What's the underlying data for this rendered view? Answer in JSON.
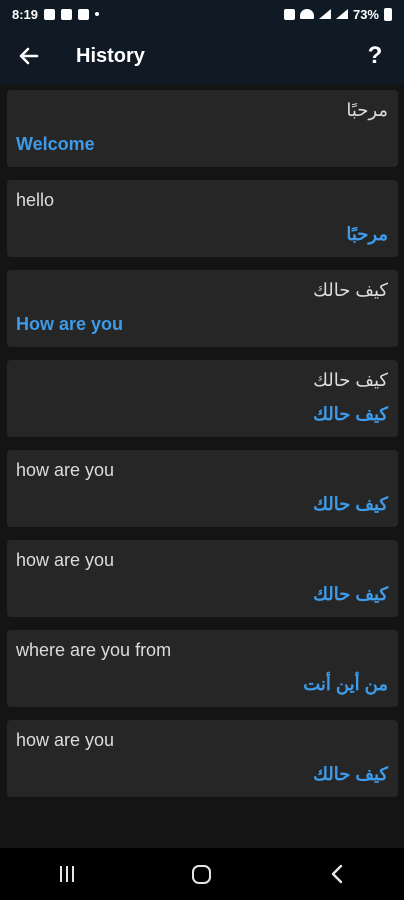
{
  "status_bar": {
    "time": "8:19",
    "battery": "73%"
  },
  "app_bar": {
    "back_icon": "arrow-left-icon",
    "title": "History",
    "help_label": "?"
  },
  "history": [
    {
      "source": "مرحبًا",
      "translation": "Welcome",
      "source_rtl": true,
      "translation_rtl": false
    },
    {
      "source": "hello",
      "translation": "مرحبًا",
      "source_rtl": false,
      "translation_rtl": true
    },
    {
      "source": "كيف حالك",
      "translation": "How are you",
      "source_rtl": true,
      "translation_rtl": false
    },
    {
      "source": "كيف حالك",
      "translation": "كيف حالك",
      "source_rtl": true,
      "translation_rtl": true
    },
    {
      "source": "how are you",
      "translation": "كيف حالك",
      "source_rtl": false,
      "translation_rtl": true
    },
    {
      "source": "how are you",
      "translation": "كيف حالك",
      "source_rtl": false,
      "translation_rtl": true
    },
    {
      "source": "where are you from",
      "translation": "من أين أنت",
      "source_rtl": false,
      "translation_rtl": true
    },
    {
      "source": "how are you",
      "translation": "كيف حالك",
      "source_rtl": false,
      "translation_rtl": true
    }
  ],
  "nav_bar": {
    "recents_icon": "recent-apps-icon",
    "home_icon": "home-icon",
    "back_icon": "back-icon"
  }
}
